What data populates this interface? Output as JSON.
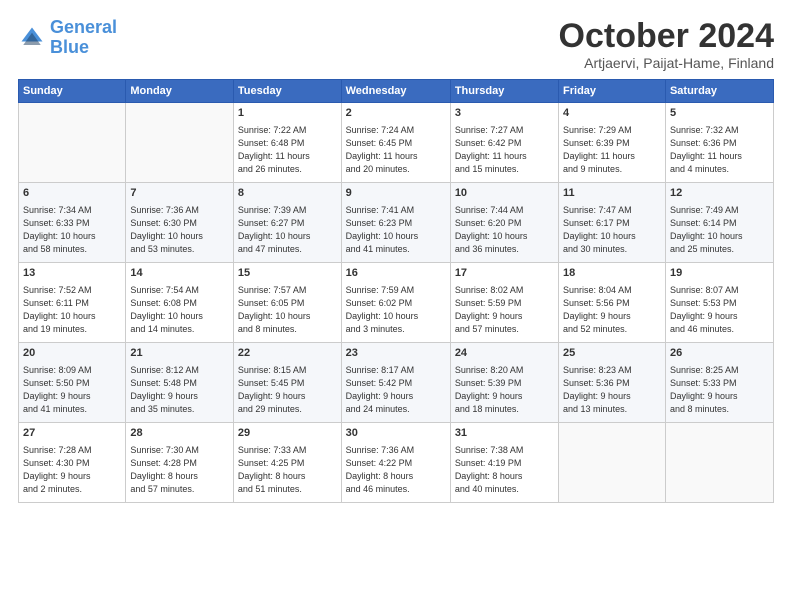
{
  "header": {
    "logo_line1": "General",
    "logo_line2": "Blue",
    "month": "October 2024",
    "location": "Artjaervi, Paijat-Hame, Finland"
  },
  "weekdays": [
    "Sunday",
    "Monday",
    "Tuesday",
    "Wednesday",
    "Thursday",
    "Friday",
    "Saturday"
  ],
  "weeks": [
    [
      {
        "day": "",
        "info": ""
      },
      {
        "day": "",
        "info": ""
      },
      {
        "day": "1",
        "info": "Sunrise: 7:22 AM\nSunset: 6:48 PM\nDaylight: 11 hours\nand 26 minutes."
      },
      {
        "day": "2",
        "info": "Sunrise: 7:24 AM\nSunset: 6:45 PM\nDaylight: 11 hours\nand 20 minutes."
      },
      {
        "day": "3",
        "info": "Sunrise: 7:27 AM\nSunset: 6:42 PM\nDaylight: 11 hours\nand 15 minutes."
      },
      {
        "day": "4",
        "info": "Sunrise: 7:29 AM\nSunset: 6:39 PM\nDaylight: 11 hours\nand 9 minutes."
      },
      {
        "day": "5",
        "info": "Sunrise: 7:32 AM\nSunset: 6:36 PM\nDaylight: 11 hours\nand 4 minutes."
      }
    ],
    [
      {
        "day": "6",
        "info": "Sunrise: 7:34 AM\nSunset: 6:33 PM\nDaylight: 10 hours\nand 58 minutes."
      },
      {
        "day": "7",
        "info": "Sunrise: 7:36 AM\nSunset: 6:30 PM\nDaylight: 10 hours\nand 53 minutes."
      },
      {
        "day": "8",
        "info": "Sunrise: 7:39 AM\nSunset: 6:27 PM\nDaylight: 10 hours\nand 47 minutes."
      },
      {
        "day": "9",
        "info": "Sunrise: 7:41 AM\nSunset: 6:23 PM\nDaylight: 10 hours\nand 41 minutes."
      },
      {
        "day": "10",
        "info": "Sunrise: 7:44 AM\nSunset: 6:20 PM\nDaylight: 10 hours\nand 36 minutes."
      },
      {
        "day": "11",
        "info": "Sunrise: 7:47 AM\nSunset: 6:17 PM\nDaylight: 10 hours\nand 30 minutes."
      },
      {
        "day": "12",
        "info": "Sunrise: 7:49 AM\nSunset: 6:14 PM\nDaylight: 10 hours\nand 25 minutes."
      }
    ],
    [
      {
        "day": "13",
        "info": "Sunrise: 7:52 AM\nSunset: 6:11 PM\nDaylight: 10 hours\nand 19 minutes."
      },
      {
        "day": "14",
        "info": "Sunrise: 7:54 AM\nSunset: 6:08 PM\nDaylight: 10 hours\nand 14 minutes."
      },
      {
        "day": "15",
        "info": "Sunrise: 7:57 AM\nSunset: 6:05 PM\nDaylight: 10 hours\nand 8 minutes."
      },
      {
        "day": "16",
        "info": "Sunrise: 7:59 AM\nSunset: 6:02 PM\nDaylight: 10 hours\nand 3 minutes."
      },
      {
        "day": "17",
        "info": "Sunrise: 8:02 AM\nSunset: 5:59 PM\nDaylight: 9 hours\nand 57 minutes."
      },
      {
        "day": "18",
        "info": "Sunrise: 8:04 AM\nSunset: 5:56 PM\nDaylight: 9 hours\nand 52 minutes."
      },
      {
        "day": "19",
        "info": "Sunrise: 8:07 AM\nSunset: 5:53 PM\nDaylight: 9 hours\nand 46 minutes."
      }
    ],
    [
      {
        "day": "20",
        "info": "Sunrise: 8:09 AM\nSunset: 5:50 PM\nDaylight: 9 hours\nand 41 minutes."
      },
      {
        "day": "21",
        "info": "Sunrise: 8:12 AM\nSunset: 5:48 PM\nDaylight: 9 hours\nand 35 minutes."
      },
      {
        "day": "22",
        "info": "Sunrise: 8:15 AM\nSunset: 5:45 PM\nDaylight: 9 hours\nand 29 minutes."
      },
      {
        "day": "23",
        "info": "Sunrise: 8:17 AM\nSunset: 5:42 PM\nDaylight: 9 hours\nand 24 minutes."
      },
      {
        "day": "24",
        "info": "Sunrise: 8:20 AM\nSunset: 5:39 PM\nDaylight: 9 hours\nand 18 minutes."
      },
      {
        "day": "25",
        "info": "Sunrise: 8:23 AM\nSunset: 5:36 PM\nDaylight: 9 hours\nand 13 minutes."
      },
      {
        "day": "26",
        "info": "Sunrise: 8:25 AM\nSunset: 5:33 PM\nDaylight: 9 hours\nand 8 minutes."
      }
    ],
    [
      {
        "day": "27",
        "info": "Sunrise: 7:28 AM\nSunset: 4:30 PM\nDaylight: 9 hours\nand 2 minutes."
      },
      {
        "day": "28",
        "info": "Sunrise: 7:30 AM\nSunset: 4:28 PM\nDaylight: 8 hours\nand 57 minutes."
      },
      {
        "day": "29",
        "info": "Sunrise: 7:33 AM\nSunset: 4:25 PM\nDaylight: 8 hours\nand 51 minutes."
      },
      {
        "day": "30",
        "info": "Sunrise: 7:36 AM\nSunset: 4:22 PM\nDaylight: 8 hours\nand 46 minutes."
      },
      {
        "day": "31",
        "info": "Sunrise: 7:38 AM\nSunset: 4:19 PM\nDaylight: 8 hours\nand 40 minutes."
      },
      {
        "day": "",
        "info": ""
      },
      {
        "day": "",
        "info": ""
      }
    ]
  ]
}
